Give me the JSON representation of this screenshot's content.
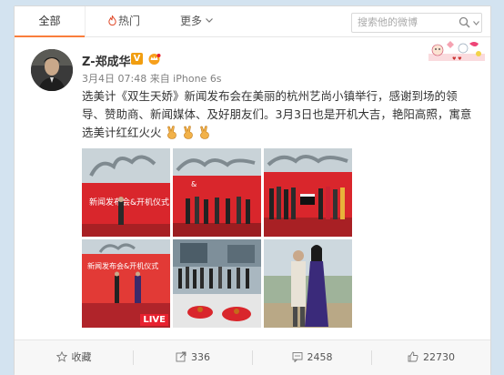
{
  "tabs": {
    "all": "全部",
    "hot": "热门",
    "more": "更多"
  },
  "search": {
    "placeholder": "搜索他的微博"
  },
  "post": {
    "username": "Z-郑成华",
    "vip_badge": "V",
    "meta": "3月4日 07:48 来自 iPhone 6s",
    "text": "选美计《双生天娇》新闻发布会在美丽的杭州艺尚小镇举行，感谢到场的领导、赞助商、新闻媒体、及好朋友们。3月3日也是开机大吉，艳阳高照，寓意选美计红红火火",
    "emoji_names": [
      "victory-hand-icon",
      "victory-hand-icon",
      "victory-hand-icon"
    ],
    "photos": [
      {
        "name": "photo-press-stage-1"
      },
      {
        "name": "photo-press-stage-2"
      },
      {
        "name": "photo-group-on-stage"
      },
      {
        "name": "photo-red-banner-hosts"
      },
      {
        "name": "photo-outdoor-crowd"
      },
      {
        "name": "photo-couple-portrait"
      }
    ],
    "live_badge": "LIVE",
    "banner_text": "新闻发布会&开机仪式"
  },
  "actions": {
    "favorite": "收藏",
    "repost": "336",
    "comment": "2458",
    "like": "22730"
  },
  "colors": {
    "page_bg": "#d3e3f0",
    "accent": "#fa7d3c",
    "banner_red": "#d9262c"
  }
}
